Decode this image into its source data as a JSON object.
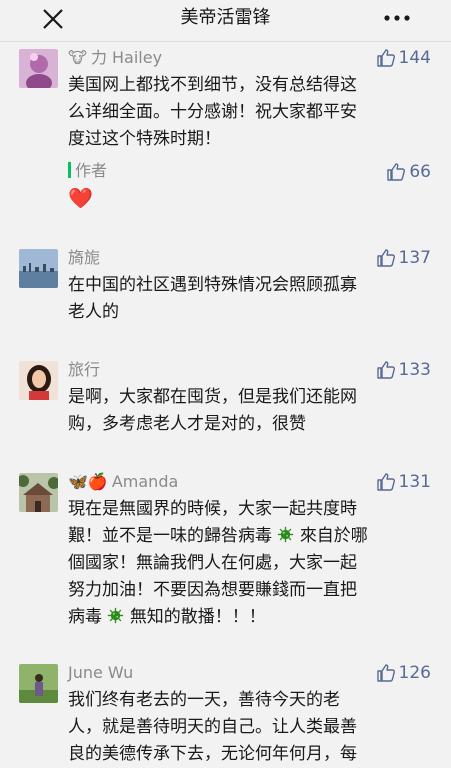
{
  "header": {
    "title": "美帝活雷锋",
    "close_icon": "close-icon",
    "more_icon": "more-icon"
  },
  "colors": {
    "like_blue": "#576b95",
    "author_green": "#07c160",
    "virus_green": "#2e8b1e"
  },
  "comments": [
    {
      "emoji": "🐮",
      "name": "力 Hailey",
      "likes": "144",
      "lines": [
        "美国网上都找不到细节，没有总结得这",
        "么详细全面。十分感谢！祝大家都平安",
        "度过这个特殊时期！"
      ]
    },
    {
      "name": "旖旎",
      "likes": "137",
      "lines": [
        "在中国的社区遇到特殊情况会照顾孤寡",
        "老人的"
      ]
    },
    {
      "name": "旅行",
      "likes": "133",
      "lines": [
        "是啊，大家都在囤货，但是我们还能网",
        "购，多考虑老人才是对的，很赞"
      ]
    },
    {
      "emoji": "🦋🍎",
      "name": "Amanda",
      "likes": "131",
      "lines": [
        "現在是無國界的時候，大家一起共度時",
        "艱！並不是一味的歸咎病毒",
        "來自於哪",
        "個國家！無論我們人在何處，大家一起",
        "努力加油！不要因為想要賺錢而一直把",
        "病毒",
        "無知的散播！！！"
      ]
    },
    {
      "name": "June Wu",
      "likes": "126",
      "lines": [
        "我们终有老去的一天，善待今天的老",
        "人，就是善待明天的自己。让人类最善",
        "良的美德传承下去，无论何年何月，每"
      ]
    }
  ],
  "author_reply": {
    "tag": "作者",
    "likes": "66",
    "content": "❤️"
  }
}
